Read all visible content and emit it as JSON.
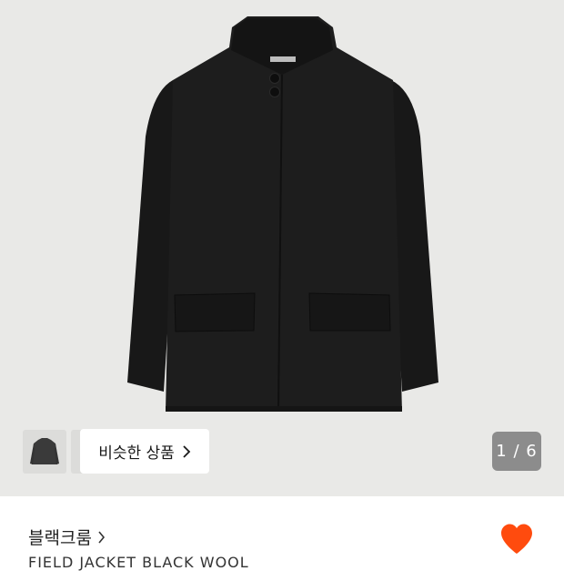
{
  "gallery": {
    "similar_button_label": "비슷한 상품",
    "image_counter": "1 / 6",
    "thumbnail_icon": "jacket-thumbnail",
    "chevron_icon": "chevron-right-icon"
  },
  "product": {
    "brand": "블랙크룸",
    "brand_chevron_icon": "chevron-right-icon",
    "name": "FIELD JACKET BLACK WOOL",
    "wishlist_icon": "heart-icon",
    "wishlist_active": true
  },
  "colors": {
    "hero_background": "#e9e9e7",
    "jacket": "#1b1b1b",
    "heart": "#ff4b0e",
    "counter_background": "#8c8c8c"
  }
}
